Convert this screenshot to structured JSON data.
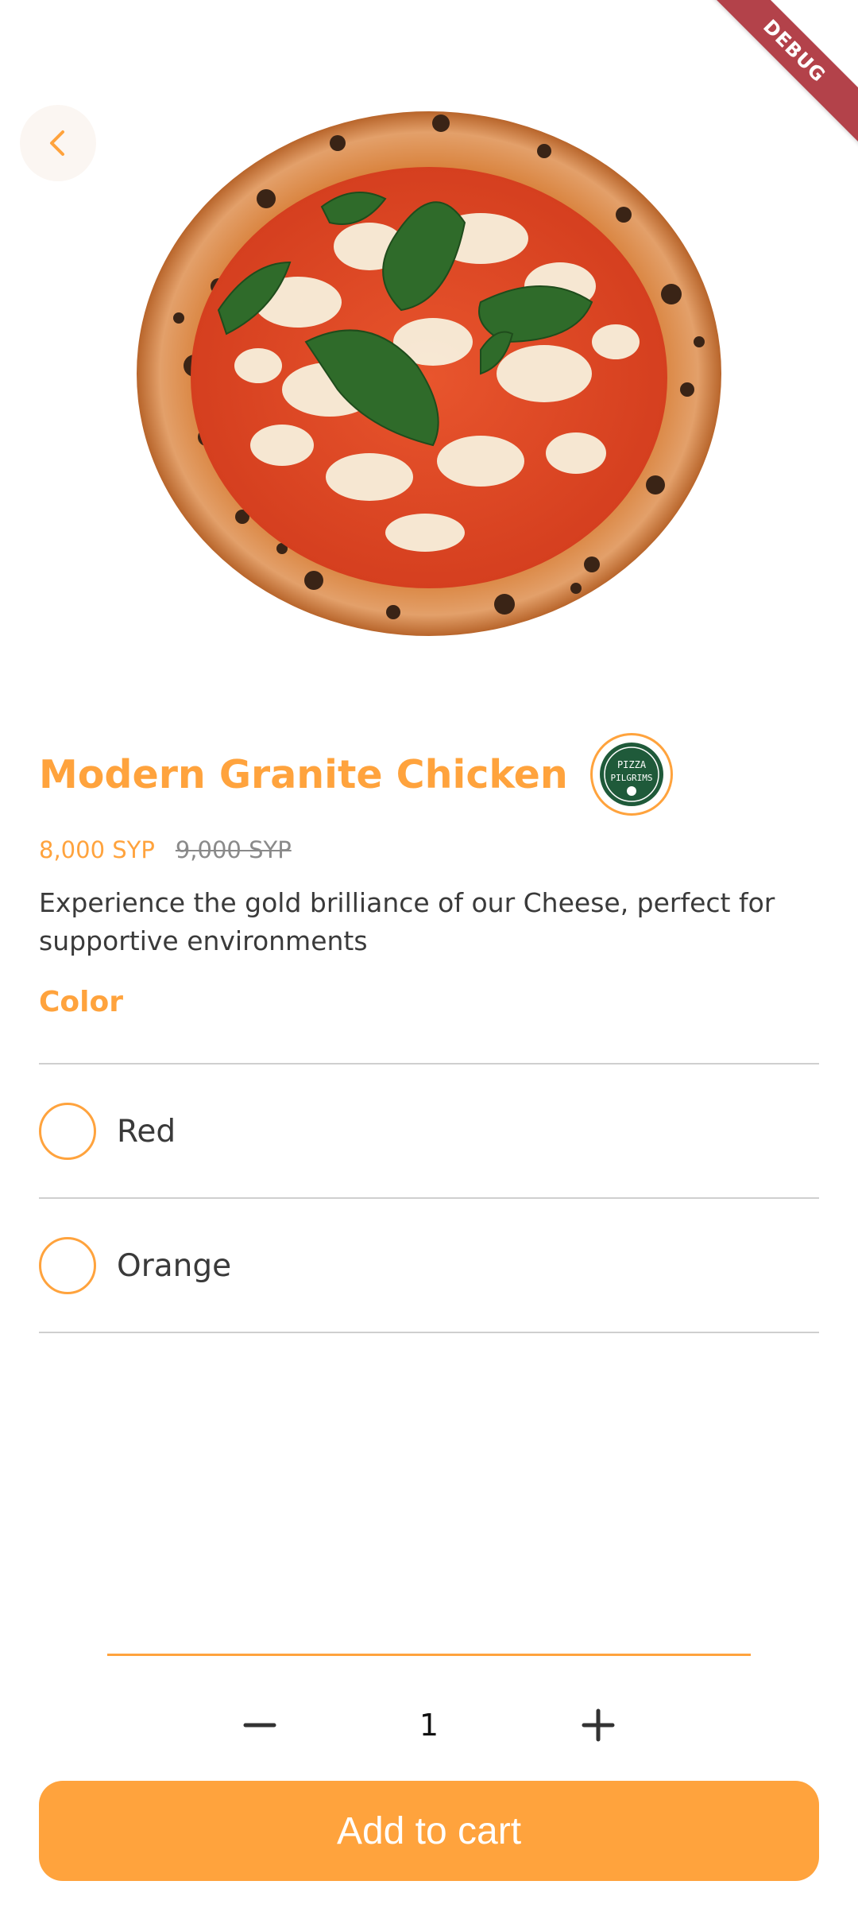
{
  "debug_banner": "DEBUG",
  "product": {
    "name": "Modern Granite Chicken",
    "price": "8,000 SYP",
    "original_price": "9,000 SYP",
    "description": "Experience the gold brilliance of our Cheese, perfect for supportive environments",
    "image_icon": "pizza-image",
    "brand": {
      "logo_line1": "PIZZA",
      "logo_line2": "PILGRIMS"
    }
  },
  "options": {
    "section_title": "Color",
    "items": [
      {
        "label": "Red",
        "selected": false
      },
      {
        "label": "Orange",
        "selected": false
      }
    ]
  },
  "quantity": {
    "value": "1",
    "minus_icon": "minus-icon",
    "plus_icon": "plus-icon"
  },
  "actions": {
    "add_to_cart": "Add to cart",
    "back_icon": "chevron-left-icon"
  },
  "colors": {
    "accent": "#ffa33d",
    "text": "#3a3a3a",
    "muted": "#8a8a8a",
    "divider": "#cfcfcf",
    "debug": "#b3424a"
  }
}
